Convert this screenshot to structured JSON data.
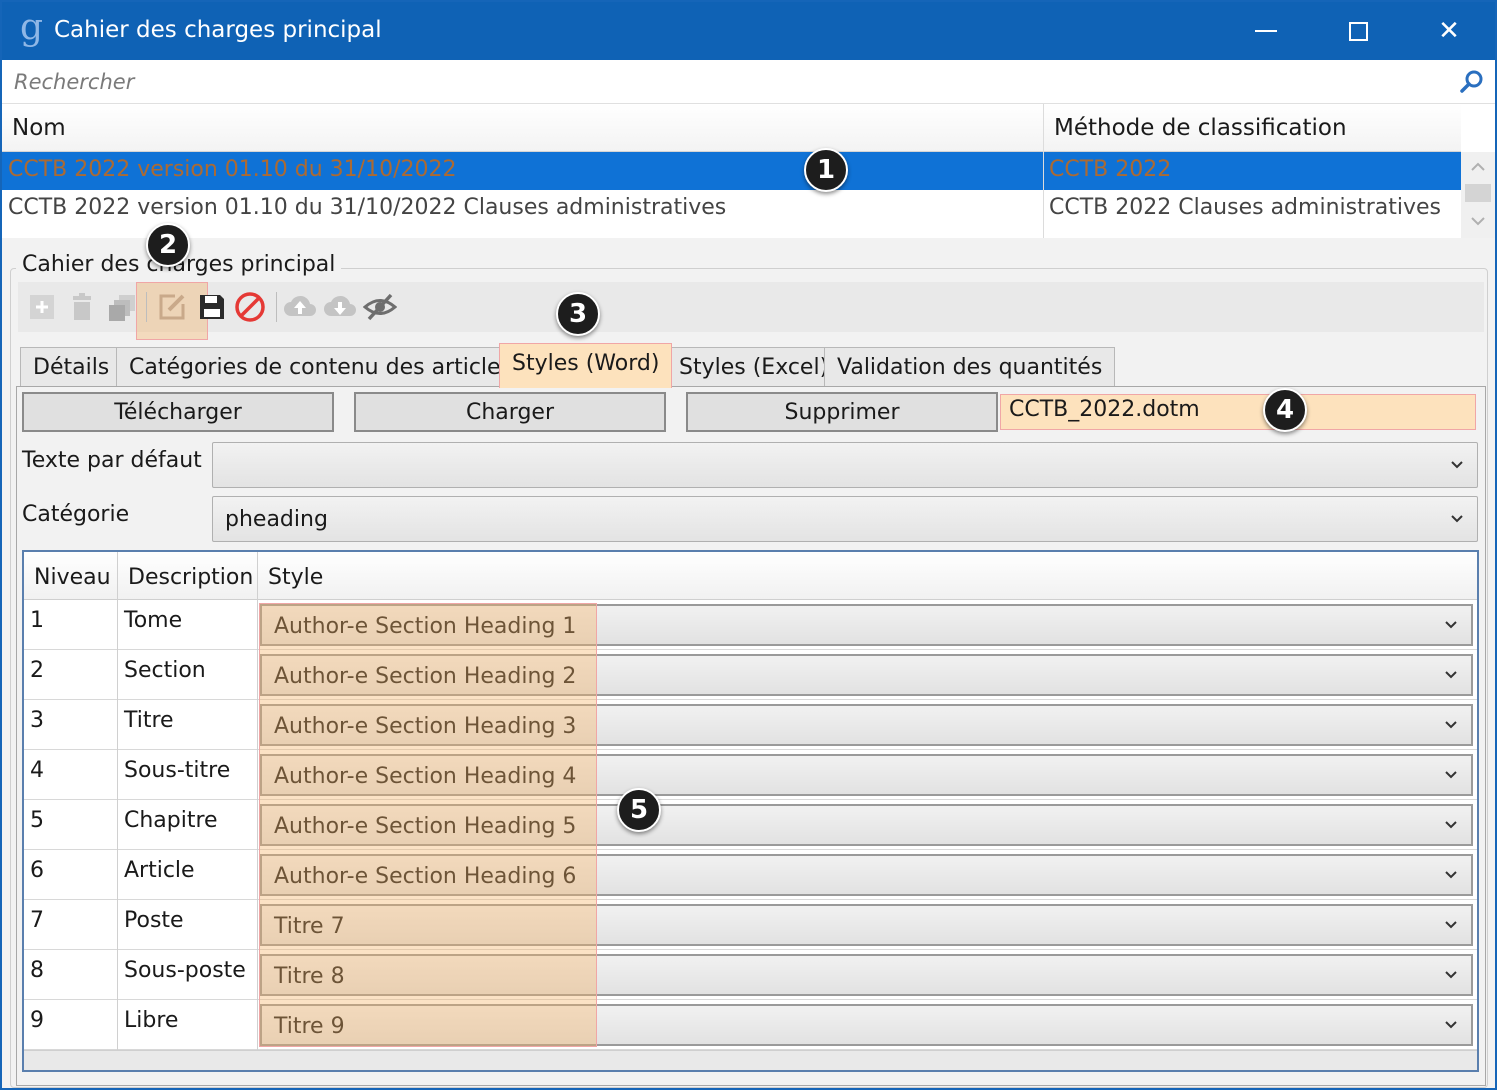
{
  "window": {
    "title": "Cahier des charges principal",
    "minimize_glyph": "—",
    "close_glyph": "✕"
  },
  "search": {
    "placeholder": "Rechercher"
  },
  "top_grid": {
    "columns": [
      "Nom",
      "Méthode de classification"
    ],
    "rows": [
      {
        "nom": "CCTB 2022 version 01.10 du 31/10/2022",
        "methode": "CCTB 2022",
        "selected": true
      },
      {
        "nom": "CCTB 2022 version 01.10 du 31/10/2022 Clauses administratives",
        "methode": "CCTB 2022 Clauses administratives",
        "selected": false
      }
    ]
  },
  "group": {
    "title": "Cahier des charges principal",
    "toolbar_icons": [
      "add-icon",
      "delete-icon",
      "copy-icon",
      "edit-icon",
      "save-icon",
      "cancel-icon",
      "upload-icon",
      "download-icon",
      "hide-icon"
    ]
  },
  "tabs": [
    {
      "label": "Détails",
      "active": false
    },
    {
      "label": "Catégories de contenu des articles",
      "active": false
    },
    {
      "label": "Styles (Word)",
      "active": true
    },
    {
      "label": "Styles (Excel)",
      "active": false
    },
    {
      "label": "Validation des quantités",
      "active": false
    }
  ],
  "styles_word": {
    "buttons": {
      "telecharger": "Télécharger",
      "charger": "Charger",
      "supprimer": "Supprimer"
    },
    "file_name": "CCTB_2022.dotm",
    "texte_par_defaut": {
      "label": "Texte par défaut",
      "value": ""
    },
    "categorie": {
      "label": "Catégorie",
      "value": "pheading"
    },
    "grid": {
      "columns": [
        "Niveau",
        "Description",
        "Style"
      ],
      "rows": [
        {
          "niveau": "1",
          "description": "Tome",
          "style": "Author-e Section Heading 1"
        },
        {
          "niveau": "2",
          "description": "Section",
          "style": "Author-e Section Heading 2"
        },
        {
          "niveau": "3",
          "description": "Titre",
          "style": "Author-e Section Heading 3"
        },
        {
          "niveau": "4",
          "description": "Sous-titre",
          "style": "Author-e Section Heading 4"
        },
        {
          "niveau": "5",
          "description": "Chapitre",
          "style": "Author-e Section Heading 5"
        },
        {
          "niveau": "6",
          "description": "Article",
          "style": "Author-e Section Heading 6"
        },
        {
          "niveau": "7",
          "description": "Poste",
          "style": "Titre 7"
        },
        {
          "niveau": "8",
          "description": "Sous-poste",
          "style": "Titre 8"
        },
        {
          "niveau": "9",
          "description": "Libre",
          "style": "Titre 9"
        }
      ]
    }
  },
  "callouts": [
    "1",
    "2",
    "3",
    "4",
    "5"
  ],
  "colors": {
    "title_bar": "#0f62b5",
    "selection": "#0f72d6",
    "highlight": "#fde2bd",
    "highlight_border": "#f0a6a6",
    "callout": "#1d1d1d",
    "cancel_red": "#e53935"
  }
}
